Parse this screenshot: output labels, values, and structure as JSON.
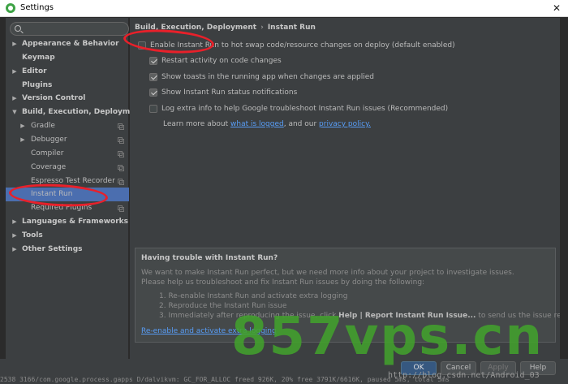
{
  "window": {
    "title": "Settings",
    "close_glyph": "✕"
  },
  "search": {
    "value": "",
    "placeholder": ""
  },
  "sidebar": {
    "items": [
      {
        "label": "Appearance & Behavior",
        "bold": true,
        "arrow": "▶"
      },
      {
        "label": "Keymap",
        "bold": true,
        "arrow": ""
      },
      {
        "label": "Editor",
        "bold": true,
        "arrow": "▶"
      },
      {
        "label": "Plugins",
        "bold": true,
        "arrow": ""
      },
      {
        "label": "Version Control",
        "bold": true,
        "arrow": "▶"
      },
      {
        "label": "Build, Execution, Deployment",
        "bold": true,
        "arrow": "▼"
      },
      {
        "label": "Gradle",
        "bold": false,
        "arrow": "▶"
      },
      {
        "label": "Debugger",
        "bold": false,
        "arrow": "▶"
      },
      {
        "label": "Compiler",
        "bold": false,
        "arrow": ""
      },
      {
        "label": "Coverage",
        "bold": false,
        "arrow": ""
      },
      {
        "label": "Espresso Test Recorder",
        "bold": false,
        "arrow": ""
      },
      {
        "label": "Instant Run",
        "bold": false,
        "arrow": "",
        "selected": true
      },
      {
        "label": "Required Plugins",
        "bold": false,
        "arrow": ""
      },
      {
        "label": "Languages & Frameworks",
        "bold": true,
        "arrow": "▶"
      },
      {
        "label": "Tools",
        "bold": true,
        "arrow": "▶"
      },
      {
        "label": "Other Settings",
        "bold": true,
        "arrow": "▶"
      }
    ]
  },
  "main": {
    "breadcrumb": {
      "parent": "Build, Execution, Deployment",
      "separator": "›",
      "current": "Instant Run"
    },
    "options": [
      {
        "label": "Enable Instant Run to hot swap code/resource changes on deploy (default enabled)",
        "checked": false
      },
      {
        "label": "Restart activity on code changes",
        "checked": true
      },
      {
        "label": "Show toasts in the running app when changes are applied",
        "checked": true
      },
      {
        "label": "Show Instant Run status notifications",
        "checked": true
      },
      {
        "label": "Log extra info to help Google troubleshoot Instant Run issues (Recommended)",
        "checked": false
      }
    ],
    "learn": {
      "prefix": "Learn more about ",
      "link1": "what is logged",
      "middle": ", and our ",
      "link2": "privacy policy."
    },
    "trouble": {
      "title": "Having trouble with Instant Run?",
      "line1": "We want to make Instant Run perfect, but we need more info about your project to investigate issues.",
      "line2": "Please help us troubleshoot and fix Instant Run issues by doing the following:",
      "step1": "1. Re-enable Instant Run and activate extra logging",
      "step2": "2. Reproduce the Instant Run issue",
      "step3_prefix": "3. Immediately after reproducing the issue, click ",
      "step3_bold": "Help | Report Instant Run Issue...",
      "step3_suffix": " to send us the issue report.",
      "link": "Re-enable and activate extra logging"
    }
  },
  "buttons": {
    "ok": "OK",
    "cancel": "Cancel",
    "apply": "Apply",
    "help": "Help"
  },
  "background": {
    "console": "2538 3166/com.google.process.gapps D/dalvikvm: GC_FOR_ALLOC freed 926K, 20% free 3791K/6616K, paused 5ms, total 5ms",
    "watermark_url": "http://blog.csdn.net/Android_03",
    "watermark_big": "857vps.cn"
  },
  "colors": {
    "selection": "#4b6eaf",
    "link": "#589df6",
    "annotation": "#e8202a"
  }
}
